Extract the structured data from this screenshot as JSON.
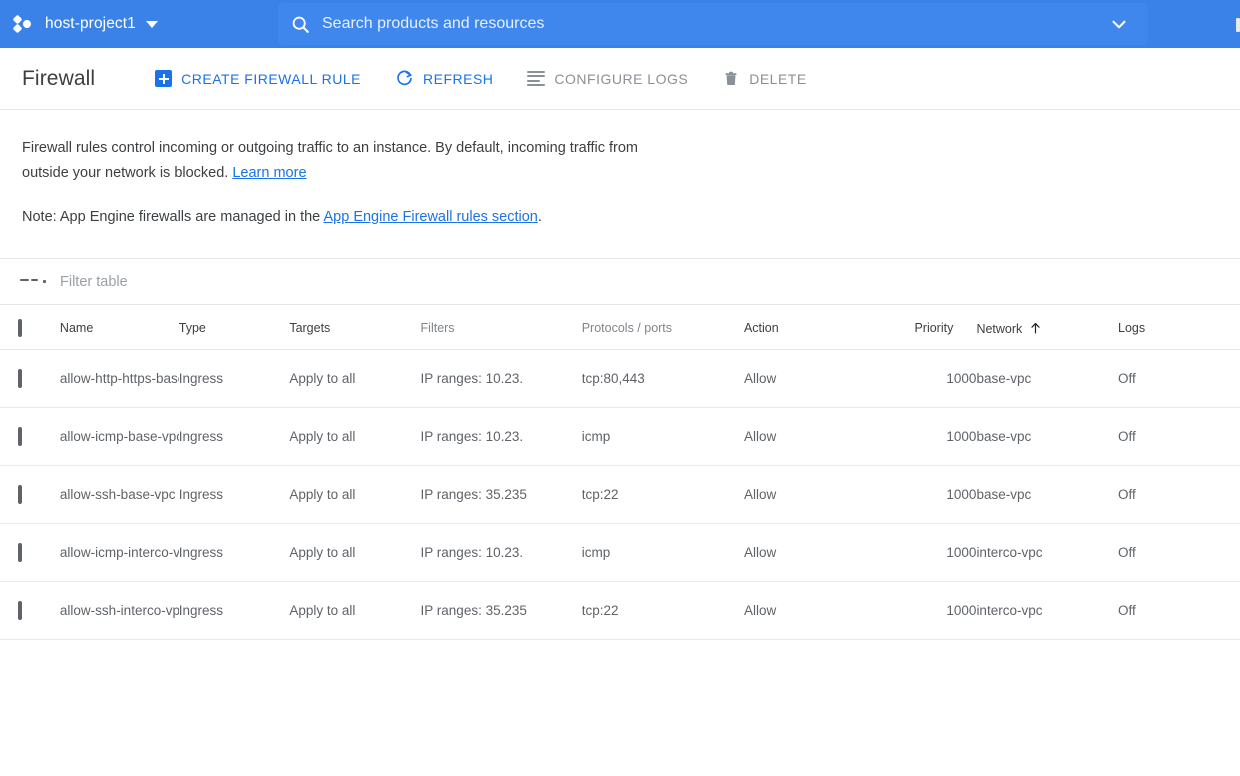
{
  "topbar": {
    "project_name": "host-project1",
    "logo_icon": "gcp-logo-icon",
    "caret_icon": "chevron-down-icon",
    "search_icon": "search-icon",
    "search_placeholder": "Search products and resources",
    "search_value": "",
    "search_caret_icon": "chevron-down-icon",
    "background_color": "#3b82e8",
    "search_background_color": "#3f87ec"
  },
  "toolbar": {
    "page_title": "Firewall",
    "buttons": [
      {
        "label": "CREATE FIREWALL RULE",
        "icon": "plus-square-icon",
        "style": "primary"
      },
      {
        "label": "REFRESH",
        "icon": "refresh-icon",
        "style": "primary"
      },
      {
        "label": "CONFIGURE LOGS",
        "icon": "log-lines-icon",
        "style": "muted"
      },
      {
        "label": "DELETE",
        "icon": "trash-icon",
        "style": "muted"
      }
    ],
    "primary_color": "#1a73e8",
    "muted_color": "#8b9096"
  },
  "description": {
    "paragraph": "Firewall rules control incoming or outgoing traffic to an instance. By default, incoming traffic from outside your network is blocked.",
    "learn_more_link": "Learn more",
    "note_prefix": "Note: App Engine firewalls are managed in the",
    "note_link": "App Engine Firewall rules section",
    "note_suffix": "."
  },
  "filter": {
    "icon": "filter-icon",
    "placeholder": "Filter table",
    "value": ""
  },
  "table": {
    "select_all_checkbox": "unchecked",
    "sort_column": "Network",
    "sort_direction": "ascending",
    "sort_icon": "arrow-up-icon",
    "columns": [
      {
        "label": "Name",
        "emphasis": "dark",
        "align": "left"
      },
      {
        "label": "Type",
        "emphasis": "dark",
        "align": "left"
      },
      {
        "label": "Targets",
        "emphasis": "dark",
        "align": "left"
      },
      {
        "label": "Filters",
        "emphasis": "light",
        "align": "left"
      },
      {
        "label": "Protocols / ports",
        "emphasis": "light",
        "align": "left"
      },
      {
        "label": "Action",
        "emphasis": "dark",
        "align": "left"
      },
      {
        "label": "Priority",
        "emphasis": "dark",
        "align": "right"
      },
      {
        "label": "Network",
        "emphasis": "dark",
        "align": "left"
      },
      {
        "label": "Logs",
        "emphasis": "dark",
        "align": "left"
      }
    ],
    "rows": [
      {
        "checked": false,
        "name": "allow-http-https-base-vpc",
        "type": "Ingress",
        "targets": "Apply to all",
        "filters": "IP ranges: 10.23.",
        "protocols_ports": "tcp:80,443",
        "action": "Allow",
        "priority": "1000",
        "network": "base-vpc",
        "logs": "Off"
      },
      {
        "checked": false,
        "name": "allow-icmp-base-vpc",
        "type": "Ingress",
        "targets": "Apply to all",
        "filters": "IP ranges: 10.23.",
        "protocols_ports": "icmp",
        "action": "Allow",
        "priority": "1000",
        "network": "base-vpc",
        "logs": "Off"
      },
      {
        "checked": false,
        "name": "allow-ssh-base-vpc",
        "type": "Ingress",
        "targets": "Apply to all",
        "filters": "IP ranges: 35.235",
        "protocols_ports": "tcp:22",
        "action": "Allow",
        "priority": "1000",
        "network": "base-vpc",
        "logs": "Off"
      },
      {
        "checked": false,
        "name": "allow-icmp-interco-vpc",
        "type": "Ingress",
        "targets": "Apply to all",
        "filters": "IP ranges: 10.23.",
        "protocols_ports": "icmp",
        "action": "Allow",
        "priority": "1000",
        "network": "interco-vpc",
        "logs": "Off"
      },
      {
        "checked": false,
        "name": "allow-ssh-interco-vpc",
        "type": "Ingress",
        "targets": "Apply to all",
        "filters": "IP ranges: 35.235",
        "protocols_ports": "tcp:22",
        "action": "Allow",
        "priority": "1000",
        "network": "interco-vpc",
        "logs": "Off"
      }
    ]
  }
}
